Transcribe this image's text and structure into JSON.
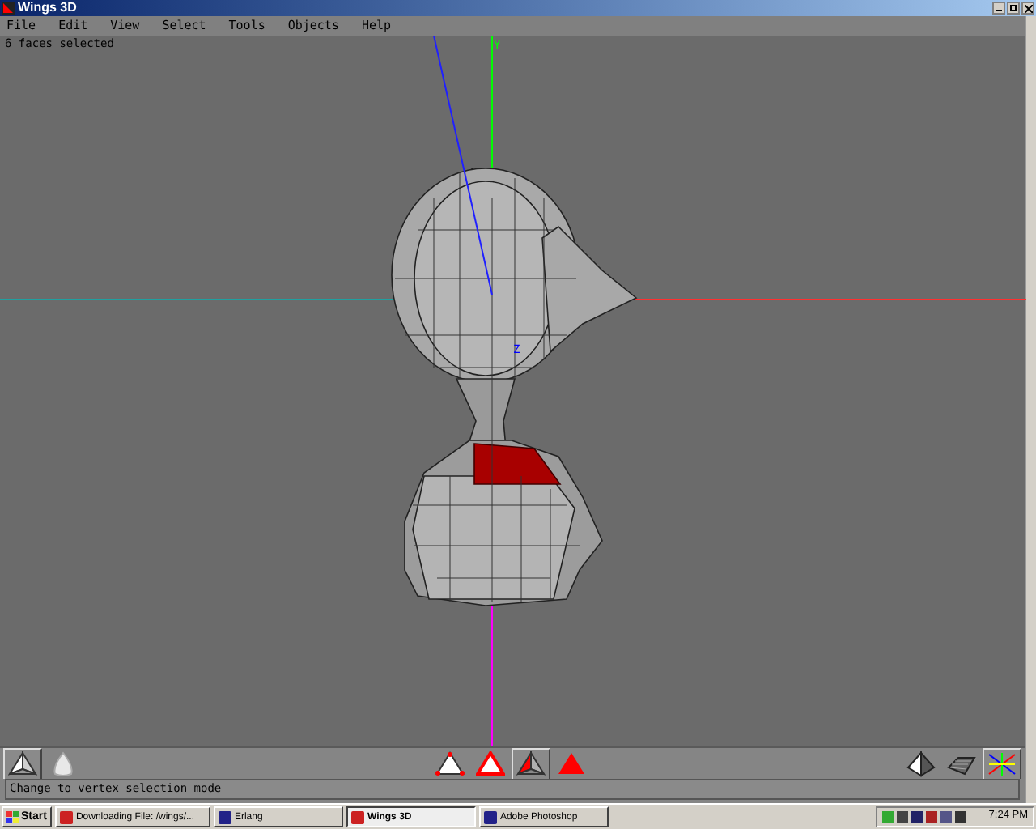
{
  "window": {
    "title": "Wings 3D"
  },
  "menu": [
    "File",
    "Edit",
    "View",
    "Select",
    "Tools",
    "Objects",
    "Help"
  ],
  "viewport": {
    "info": "6 faces selected",
    "axis_labels": [
      {
        "text": "Y",
        "color": "#00ff00"
      },
      {
        "text": "Z",
        "color": "#0000ff"
      }
    ]
  },
  "toolbar": {
    "left": [
      {
        "kind": "shaded",
        "selected": true
      },
      {
        "kind": "smooth",
        "selected": false
      }
    ],
    "modes": [
      {
        "kind": "vertex",
        "selected": false
      },
      {
        "kind": "edge",
        "selected": false
      },
      {
        "kind": "face",
        "selected": true
      },
      {
        "kind": "body",
        "selected": false
      }
    ],
    "right": [
      {
        "kind": "perspective",
        "selected": false
      },
      {
        "kind": "groundplane",
        "selected": false
      },
      {
        "kind": "axes",
        "selected": true
      }
    ]
  },
  "status_bar": "Change to vertex selection mode",
  "taskbar": {
    "start": "Start",
    "tasks": [
      {
        "label": "Downloading File: /wings/...",
        "selected": false
      },
      {
        "label": "Erlang",
        "selected": false
      },
      {
        "label": "Wings 3D",
        "selected": true
      },
      {
        "label": "Adobe Photoshop",
        "selected": false
      }
    ],
    "clock": "7:24 PM"
  }
}
